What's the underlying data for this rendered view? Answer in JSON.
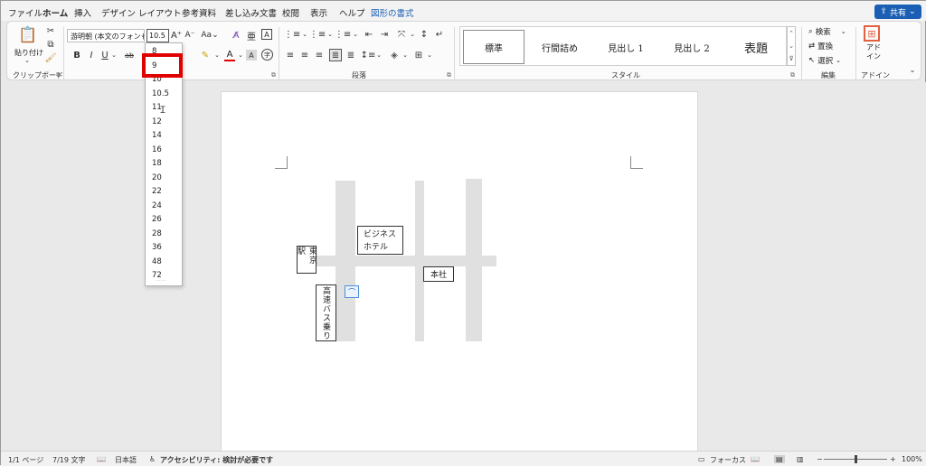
{
  "tabs": [
    {
      "label": "ファイル"
    },
    {
      "label": "ホーム"
    },
    {
      "label": "挿入"
    },
    {
      "label": "デザイン"
    },
    {
      "label": "レイアウト"
    },
    {
      "label": "参考資料"
    },
    {
      "label": "差し込み文書"
    },
    {
      "label": "校閲"
    },
    {
      "label": "表示"
    },
    {
      "label": "ヘルプ"
    },
    {
      "label": "図形の書式"
    }
  ],
  "share_label": "共有",
  "clipboard": {
    "paste_label": "貼り付け",
    "group_label": "クリップボード"
  },
  "font": {
    "name": "游明朝 (本文のフォント",
    "size": "10.5"
  },
  "paragraph": {
    "group_label": "段落"
  },
  "styles": {
    "items": [
      "標準",
      "行間詰め",
      "見出し 1",
      "見出し 2",
      "表題"
    ],
    "group_label": "スタイル"
  },
  "editing": {
    "find_label": "検索",
    "replace_label": "置換",
    "select_label": "選択",
    "group_label": "編集"
  },
  "addins": {
    "button_label": "アド\nイン",
    "group_label": "アドイン"
  },
  "font_size_dropdown": {
    "options": [
      "8",
      "9",
      "10",
      "10.5",
      "11",
      "12",
      "14",
      "16",
      "18",
      "20",
      "22",
      "24",
      "26",
      "28",
      "36",
      "48",
      "72"
    ],
    "highlighted": "9"
  },
  "map": {
    "labels": {
      "tokyo_station": "東京駅",
      "business_hotel": "ビジネス\nホテル",
      "head_office": "本社",
      "bus_stop": "高速バス乗り"
    }
  },
  "statusbar": {
    "page": "1/1 ページ",
    "words": "7/19 文字",
    "language": "日本語",
    "accessibility": "アクセシビリティ: 検討が必要です",
    "focus": "フォーカス",
    "zoom": "100%"
  }
}
